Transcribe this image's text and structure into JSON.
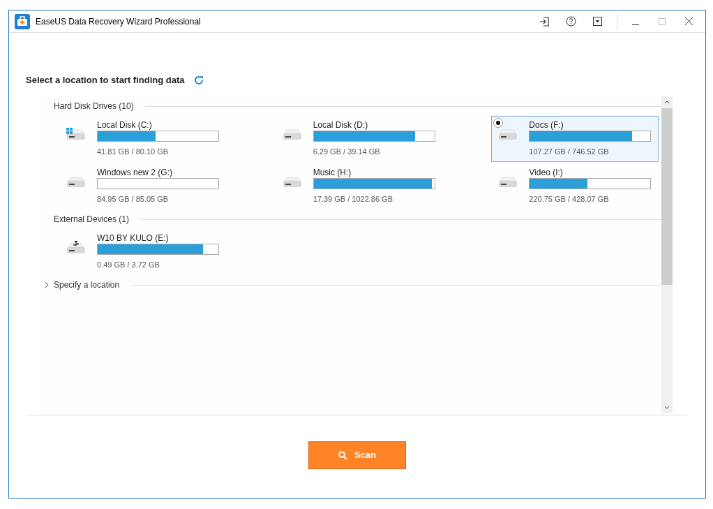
{
  "window": {
    "title": "EaseUS Data Recovery Wizard Professional"
  },
  "heading": "Select a location to start finding data",
  "groups": [
    {
      "label": "Hard Disk Drives (10)",
      "drives": [
        {
          "kind": "system",
          "name": "Local Disk (C:)",
          "level": 0.48,
          "usage": "41.81 GB / 80.10 GB",
          "selected": false
        },
        {
          "kind": "disk",
          "name": "Local Disk (D:)",
          "level": 0.84,
          "usage": "6.29 GB / 39.14 GB",
          "selected": false
        },
        {
          "kind": "disk",
          "name": "Docs (F:)",
          "level": 0.85,
          "usage": "107.27 GB / 746.52 GB",
          "selected": true
        },
        {
          "kind": "disk",
          "name": "Windows new 2 (G:)",
          "level": 0,
          "usage": "84.95 GB / 85.05 GB",
          "selected": false
        },
        {
          "kind": "disk",
          "name": "Music (H:)",
          "level": 0.98,
          "usage": "17.39 GB / 1022.86 GB",
          "selected": false
        },
        {
          "kind": "disk",
          "name": "Video (I:)",
          "level": 0.48,
          "usage": "220.75 GB / 428.07 GB",
          "selected": false
        }
      ]
    },
    {
      "label": "External Devices (1)",
      "drives": [
        {
          "kind": "usb",
          "name": "W10 BY KULO (E:)",
          "level": 0.87,
          "usage": "0.49 GB / 3.72 GB",
          "selected": false
        }
      ]
    }
  ],
  "specify": {
    "label": "Specify a location",
    "expanded": false
  },
  "scan_button": "Scan"
}
